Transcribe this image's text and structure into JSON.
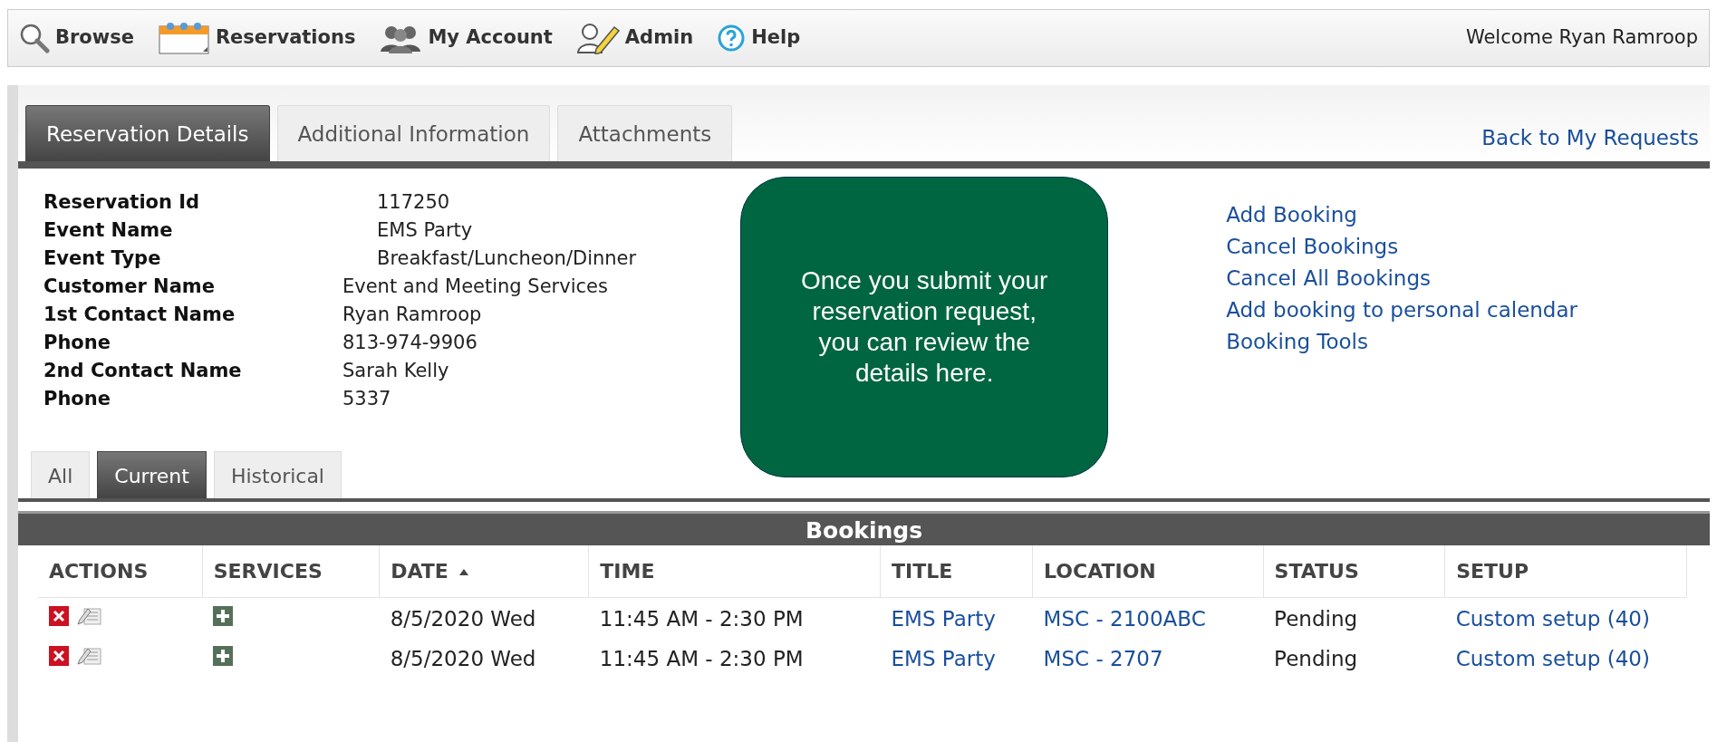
{
  "nav": {
    "items": [
      {
        "label": "Browse"
      },
      {
        "label": "Reservations"
      },
      {
        "label": "My Account"
      },
      {
        "label": "Admin"
      },
      {
        "label": "Help"
      }
    ],
    "welcome": "Welcome Ryan Ramroop"
  },
  "tabs": [
    {
      "label": "Reservation Details",
      "selected": true
    },
    {
      "label": "Additional Information",
      "selected": false
    },
    {
      "label": "Attachments",
      "selected": false
    }
  ],
  "back_link": "Back to My Requests",
  "details": [
    {
      "label": "Reservation Id",
      "value": "117250"
    },
    {
      "label": "Event Name",
      "value": "EMS Party"
    },
    {
      "label": "Event Type",
      "value": "Breakfast/Luncheon/Dinner"
    },
    {
      "label": "Customer Name",
      "value": "Event and Meeting Services"
    },
    {
      "label": "1st Contact Name",
      "value": "Ryan Ramroop"
    },
    {
      "label": "Phone",
      "value": "813-974-9906"
    },
    {
      "label": "2nd Contact Name",
      "value": "Sarah Kelly"
    },
    {
      "label": "Phone",
      "value": "5337"
    }
  ],
  "callout": "Once you submit your reservation request, you can review the details here.",
  "links": [
    "Add Booking",
    "Cancel Bookings",
    "Cancel All Bookings",
    "Add booking to personal calendar",
    "Booking Tools"
  ],
  "subtabs": [
    {
      "label": "All",
      "selected": false
    },
    {
      "label": "Current",
      "selected": true
    },
    {
      "label": "Historical",
      "selected": false
    }
  ],
  "bookings": {
    "title": "Bookings",
    "columns": [
      {
        "label": "ACTIONS",
        "sorted_ascending": false
      },
      {
        "label": "SERVICES",
        "sorted_ascending": false
      },
      {
        "label": "DATE",
        "sorted_ascending": true
      },
      {
        "label": "TIME",
        "sorted_ascending": false
      },
      {
        "label": "TITLE",
        "sorted_ascending": false
      },
      {
        "label": "LOCATION",
        "sorted_ascending": false
      },
      {
        "label": "STATUS",
        "sorted_ascending": false
      },
      {
        "label": "SETUP",
        "sorted_ascending": false
      }
    ],
    "rows": [
      {
        "date": "8/5/2020 Wed",
        "time": "11:45 AM - 2:30 PM",
        "title": "EMS Party",
        "location": "MSC - 2100ABC",
        "status": "Pending",
        "setup": "Custom setup (40)"
      },
      {
        "date": "8/5/2020 Wed",
        "time": "11:45 AM - 2:30 PM",
        "title": "EMS Party",
        "location": "MSC - 2707",
        "status": "Pending",
        "setup": "Custom setup (40)"
      }
    ]
  }
}
